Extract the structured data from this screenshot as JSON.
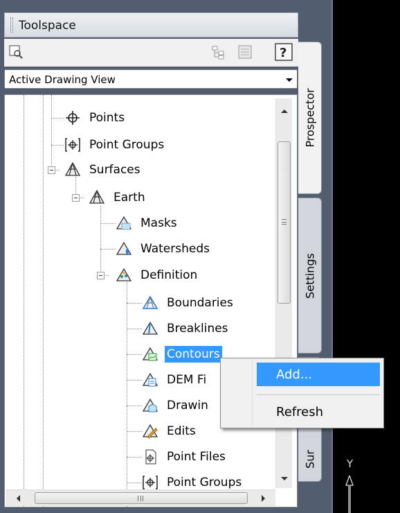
{
  "palette": {
    "title": "Toolspace",
    "view_selector": {
      "value": "Active Drawing View"
    },
    "tabs": [
      {
        "label": "Prospector",
        "active": true
      },
      {
        "label": "Settings",
        "active": false
      },
      {
        "label": "Sur",
        "active": false
      }
    ],
    "tree": [
      {
        "label": "Points",
        "icon": "point-icon"
      },
      {
        "label": "Point Groups",
        "icon": "point-group-icon"
      },
      {
        "label": "Surfaces",
        "icon": "surfaces-icon"
      },
      {
        "label": "Earth",
        "icon": "surface-icon"
      },
      {
        "label": "Masks",
        "icon": "masks-icon"
      },
      {
        "label": "Watersheds",
        "icon": "watersheds-icon"
      },
      {
        "label": "Definition",
        "icon": "definition-icon"
      },
      {
        "label": "Boundaries",
        "icon": "boundaries-icon"
      },
      {
        "label": "Breaklines",
        "icon": "breaklines-icon"
      },
      {
        "label": "Contours",
        "icon": "contours-icon",
        "selected": true
      },
      {
        "label": "DEM Fi",
        "icon": "dem-files-icon"
      },
      {
        "label": "Drawin",
        "icon": "drawing-objects-icon"
      },
      {
        "label": "Edits",
        "icon": "edits-icon"
      },
      {
        "label": "Point Files",
        "icon": "point-files-icon"
      },
      {
        "label": "Point Groups",
        "icon": "point-group-icon"
      }
    ]
  },
  "context_menu": {
    "items": [
      {
        "label": "Add...",
        "highlighted": true
      },
      {
        "label": "Refresh",
        "highlighted": false
      }
    ]
  },
  "ucs": {
    "axis_label": "Y"
  },
  "colors": {
    "selection": "#3399ff",
    "drawing_background": "#000000",
    "palette_frame": "#525e6f"
  }
}
